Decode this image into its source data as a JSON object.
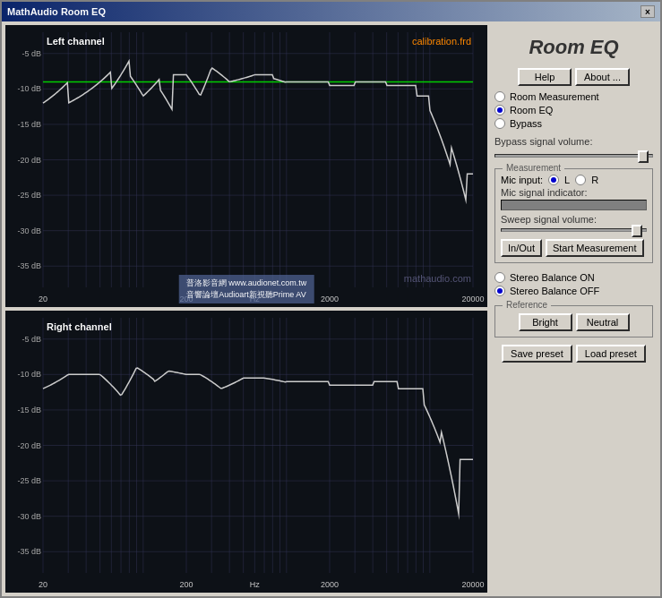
{
  "window": {
    "title": "MathAudio Room EQ",
    "close_label": "×"
  },
  "app_title": "Room EQ",
  "buttons": {
    "help": "Help",
    "about": "About ...",
    "in_out": "In/Out",
    "start_measurement": "Start Measurement",
    "bright": "Bright",
    "neutral": "Neutral",
    "save_preset": "Save preset",
    "load_preset": "Load preset"
  },
  "radio_groups": {
    "mode": [
      {
        "label": "Room Measurement",
        "selected": false
      },
      {
        "label": "Room EQ",
        "selected": true
      },
      {
        "label": "Bypass",
        "selected": false
      }
    ],
    "mic_input": [
      {
        "label": "L",
        "selected": true
      },
      {
        "label": "R",
        "selected": false
      }
    ],
    "stereo": [
      {
        "label": "Stereo Balance ON",
        "selected": false
      },
      {
        "label": "Stereo Balance OFF",
        "selected": true
      }
    ]
  },
  "labels": {
    "bypass_signal_volume": "Bypass signal volume:",
    "measurement_group": "Measurement",
    "mic_input": "Mic input:",
    "mic_signal_indicator": "Mic signal indicator:",
    "sweep_signal_volume": "Sweep signal volume:",
    "reference_group": "Reference"
  },
  "charts": {
    "left": {
      "label": "Left channel",
      "calib": "calibration.frd",
      "watermark": "mathaudio.com"
    },
    "right": {
      "label": "Right channel"
    },
    "x_labels": [
      "20",
      "200",
      "Hz",
      "2000",
      "20000"
    ],
    "y_labels": [
      "-5 dB",
      "-10 dB",
      "-15 dB",
      "-20 dB",
      "-25 dB",
      "-30 dB",
      "-35 dB"
    ]
  },
  "watermark": {
    "line1": "普洛影音網 www.audionet.com.tw",
    "line2": "音響論壇Audioart新視聽Prime AV"
  },
  "colors": {
    "accent_blue": "#0000cc",
    "orange": "#ff8800",
    "green_line": "#00cc00",
    "chart_bg": "#0d1117",
    "chart_line": "#cccccc"
  }
}
